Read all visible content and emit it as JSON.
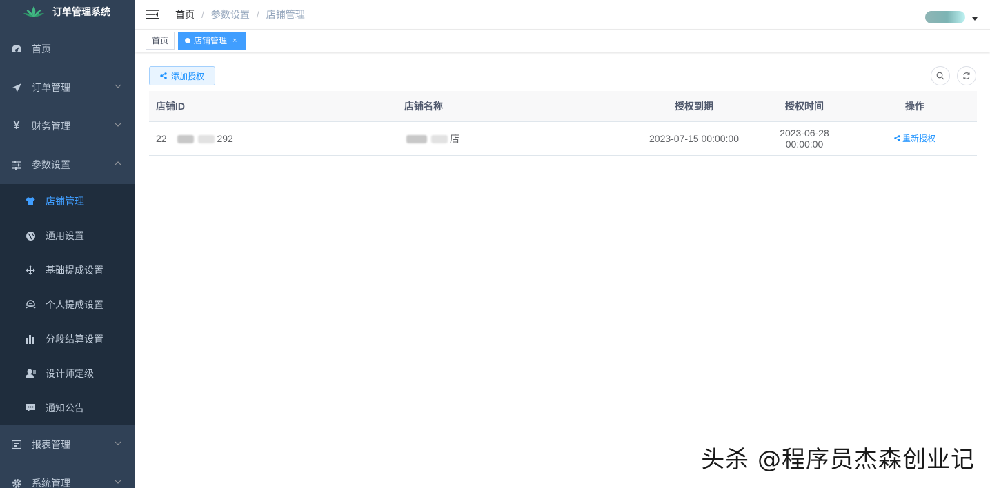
{
  "app": {
    "title": "订单管理系统"
  },
  "sidebar": {
    "items": [
      {
        "label": "首页",
        "icon": "dashboard-icon"
      },
      {
        "label": "订单管理",
        "icon": "send-icon"
      },
      {
        "label": "财务管理",
        "icon": "yen-icon"
      },
      {
        "label": "参数设置",
        "icon": "sliders-icon"
      }
    ],
    "submenu": [
      {
        "label": "店铺管理",
        "icon": "shirt-icon",
        "active": true
      },
      {
        "label": "通用设置",
        "icon": "globe-icon"
      },
      {
        "label": "基础提成设置",
        "icon": "move-icon"
      },
      {
        "label": "个人提成设置",
        "icon": "person-icon"
      },
      {
        "label": "分段结算设置",
        "icon": "bar-chart-icon"
      },
      {
        "label": "设计师定级",
        "icon": "user-icon"
      },
      {
        "label": "通知公告",
        "icon": "message-icon"
      }
    ],
    "bottom_items": [
      {
        "label": "报表管理",
        "icon": "report-icon"
      },
      {
        "label": "系统管理",
        "icon": "gear-icon"
      }
    ]
  },
  "breadcrumb": [
    "首页",
    "参数设置",
    "店铺管理"
  ],
  "tags": [
    {
      "label": "首页"
    },
    {
      "label": "店铺管理",
      "close": "×"
    }
  ],
  "toolbar": {
    "add_label": "添加授权"
  },
  "table": {
    "headers": [
      "店铺ID",
      "店铺名称",
      "授权到期",
      "授权时间",
      "操作"
    ],
    "rows": [
      {
        "id_prefix": "22",
        "id_suffix": "292",
        "name_suffix": "店",
        "expire": "2023-07-15 00:00:00",
        "auth_time": "2023-06-28 00:00:00",
        "action": "重新授权"
      }
    ]
  },
  "watermark": "头杀 @程序员杰森创业记",
  "colors": {
    "sidebar": "#304156",
    "submenu": "#1f2d3d",
    "accent": "#409eff"
  }
}
